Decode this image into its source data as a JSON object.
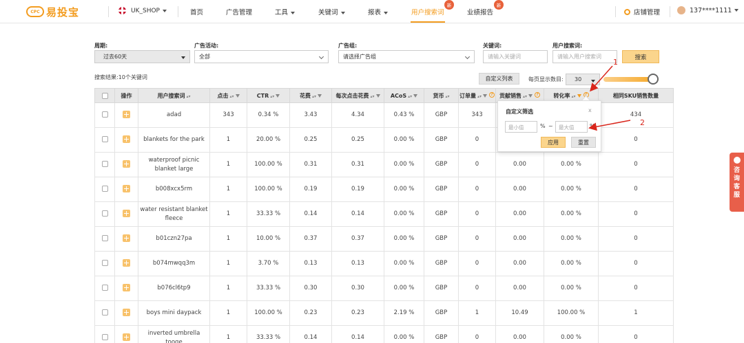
{
  "app": {
    "logo_badge": "CPC",
    "logo_text": "易投宝"
  },
  "nav": {
    "shop": "UK_SHOP",
    "items": [
      {
        "label": "首页",
        "has_caret": false
      },
      {
        "label": "广告管理",
        "has_caret": false
      },
      {
        "label": "工具",
        "has_caret": true
      },
      {
        "label": "关键词",
        "has_caret": true
      },
      {
        "label": "报表",
        "has_caret": true
      },
      {
        "label": "用户搜索词",
        "has_caret": false,
        "active": true
      },
      {
        "label": "业绩报告",
        "has_caret": false
      }
    ],
    "new_badge": "新",
    "store_mgmt": "店铺管理",
    "user": "137****1111"
  },
  "filters": {
    "period_label": "周期:",
    "period_value": "过去60天",
    "campaign_label": "广告活动:",
    "campaign_value": "全部",
    "adgroup_label": "广告组:",
    "adgroup_placeholder": "请选择广告组",
    "keyword_label": "关键词:",
    "keyword_placeholder": "请输入关键词",
    "searchterm_label": "用户搜索词:",
    "searchterm_placeholder": "请输入用户搜索词",
    "search_button": "搜索"
  },
  "toolbar": {
    "results_text": "搜索结果:10个关键词",
    "custom_columns": "自定义列表",
    "per_page_label": "每页显示数目:",
    "per_page_value": "30"
  },
  "table": {
    "headers": [
      "操作",
      "用户搜索词",
      "点击",
      "CTR",
      "花费",
      "每次点击花费",
      "ACoS",
      "货币",
      "订单量",
      "贡献销售",
      "转化率",
      "相同SKU销售数量"
    ],
    "rows": [
      [
        "adad",
        "343",
        "0.34 %",
        "3.43",
        "4.34",
        "0.43 %",
        "GBP",
        "343",
        "",
        "",
        "434"
      ],
      [
        "blankets for the park",
        "1",
        "20.00 %",
        "0.25",
        "0.25",
        "0.00 %",
        "GBP",
        "0",
        "",
        "",
        "0"
      ],
      [
        "waterproof picnic blanket large",
        "1",
        "100.00 %",
        "0.31",
        "0.31",
        "0.00 %",
        "GBP",
        "0",
        "0.00",
        "0.00 %",
        "0"
      ],
      [
        "b008xcx5rm",
        "1",
        "100.00 %",
        "0.19",
        "0.19",
        "0.00 %",
        "GBP",
        "0",
        "0.00",
        "0.00 %",
        "0"
      ],
      [
        "water resistant blanket fleece",
        "1",
        "33.33 %",
        "0.14",
        "0.14",
        "0.00 %",
        "GBP",
        "0",
        "0.00",
        "0.00 %",
        "0"
      ],
      [
        "b01czn27pa",
        "1",
        "10.00 %",
        "0.37",
        "0.37",
        "0.00 %",
        "GBP",
        "0",
        "0.00",
        "0.00 %",
        "0"
      ],
      [
        "b074mwqq3m",
        "1",
        "3.70 %",
        "0.13",
        "0.13",
        "0.00 %",
        "GBP",
        "0",
        "0.00",
        "0.00 %",
        "0"
      ],
      [
        "b076cl6tp9",
        "1",
        "33.33 %",
        "0.30",
        "0.30",
        "0.00 %",
        "GBP",
        "0",
        "0.00",
        "0.00 %",
        "0"
      ],
      [
        "boys mini daypack",
        "1",
        "100.00 %",
        "0.23",
        "0.23",
        "2.19 %",
        "GBP",
        "1",
        "10.49",
        "100.00 %",
        "1"
      ],
      [
        "inverted umbrella tooge",
        "1",
        "33.33 %",
        "0.14",
        "0.14",
        "0.00 %",
        "GBP",
        "0",
        "0.00",
        "0.00 %",
        "0"
      ]
    ]
  },
  "popup": {
    "title": "自定义筛选",
    "close": "x",
    "min_placeholder": "最小值",
    "max_placeholder": "最大值",
    "percent": "%",
    "tilde": "~",
    "apply": "应用",
    "reset": "重置"
  },
  "annotations": [
    "1",
    "2"
  ],
  "side_tab": [
    "咨",
    "询",
    "客",
    "服"
  ],
  "colors": {
    "accent": "#f39c1f",
    "annotation": "#d9261c",
    "consult": "#e85f4a"
  }
}
